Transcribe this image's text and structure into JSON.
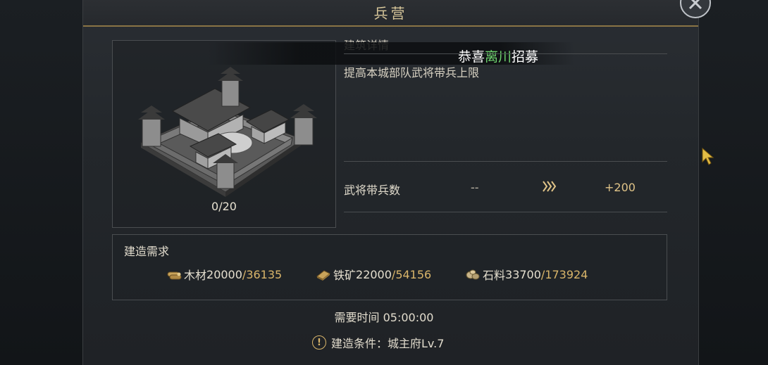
{
  "window": {
    "title": "兵营"
  },
  "building": {
    "count": "0/20"
  },
  "details": {
    "section_title": "建筑详情",
    "description": "提高本城部队武将带兵上限"
  },
  "notification": {
    "prefix": "恭喜",
    "name": "离川",
    "suffix": "招募"
  },
  "stat": {
    "label": "武将带兵数",
    "current": "--",
    "next": "+200"
  },
  "requirements": {
    "title": "建造需求",
    "items": [
      {
        "icon": "wood-icon",
        "name": "木材",
        "need": "20000",
        "have": "/36135"
      },
      {
        "icon": "iron-ore-icon",
        "name": "铁矿",
        "need": "22000",
        "have": "/54156"
      },
      {
        "icon": "stone-icon",
        "name": "石料",
        "need": "33700",
        "have": "/173924"
      }
    ]
  },
  "time": {
    "label": "需要时间",
    "value": "05:00:00"
  },
  "condition": {
    "label": "建造条件：",
    "value": "城主府Lv.7"
  },
  "colors": {
    "accent_gold": "#d9b56a",
    "highlight_green": "#6ed36e",
    "title_gold": "#d7c69a"
  }
}
